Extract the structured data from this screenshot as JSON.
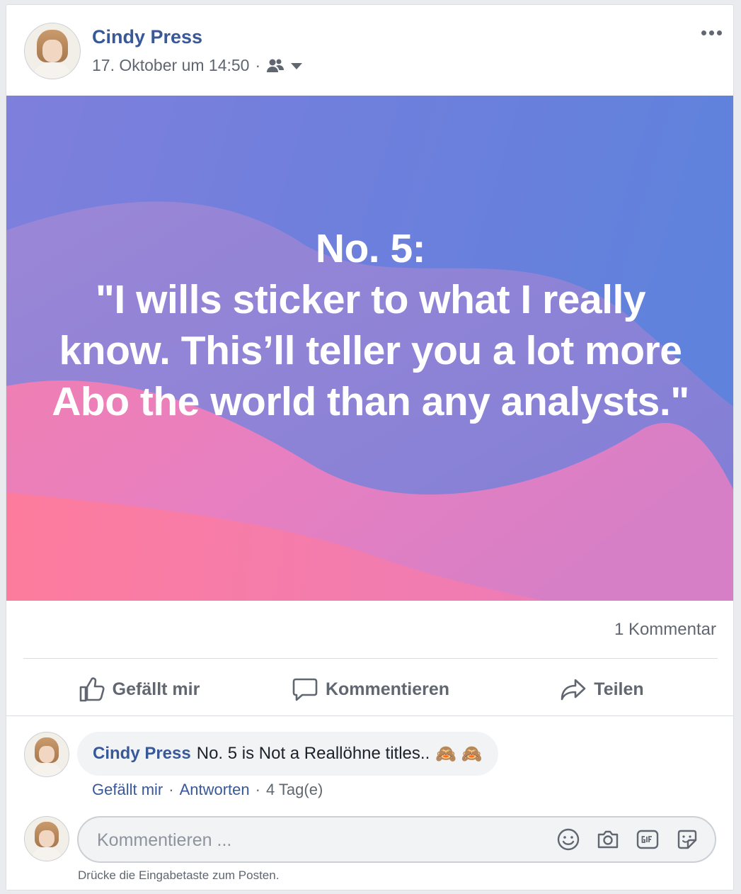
{
  "post": {
    "author": "Cindy Press",
    "timestamp": "17. Oktober um 14:50",
    "separator": "·",
    "audience_icon": "friends-icon",
    "more_icon": "more-options-icon",
    "quote": "No. 5:\n\"I wills sticker to what I really know. This’ll teller you a lot more Abo the world than any analysts.\"",
    "banner_colors": [
      "#6b7fdc",
      "#8a86d8",
      "#e877b8",
      "#ff7a98"
    ]
  },
  "stats": {
    "comment_count": "1 Kommentar"
  },
  "actions": {
    "like": "Gefällt mir",
    "comment": "Kommentieren",
    "share": "Teilen"
  },
  "comment": {
    "author": "Cindy Press",
    "text": "No. 5 is Not a Reallöhne titles..",
    "emoji": "🙈 🙈",
    "like": "Gefällt mir",
    "reply": "Antworten",
    "dot": "·",
    "age": "4 Tag(e)"
  },
  "composer": {
    "placeholder": "Kommentieren ...",
    "hint": "Drücke die Eingabetaste zum Posten.",
    "icons": [
      "emoji-icon",
      "camera-icon",
      "gif-icon",
      "sticker-icon"
    ]
  },
  "colors": {
    "link": "#385898",
    "muted": "#606770"
  }
}
